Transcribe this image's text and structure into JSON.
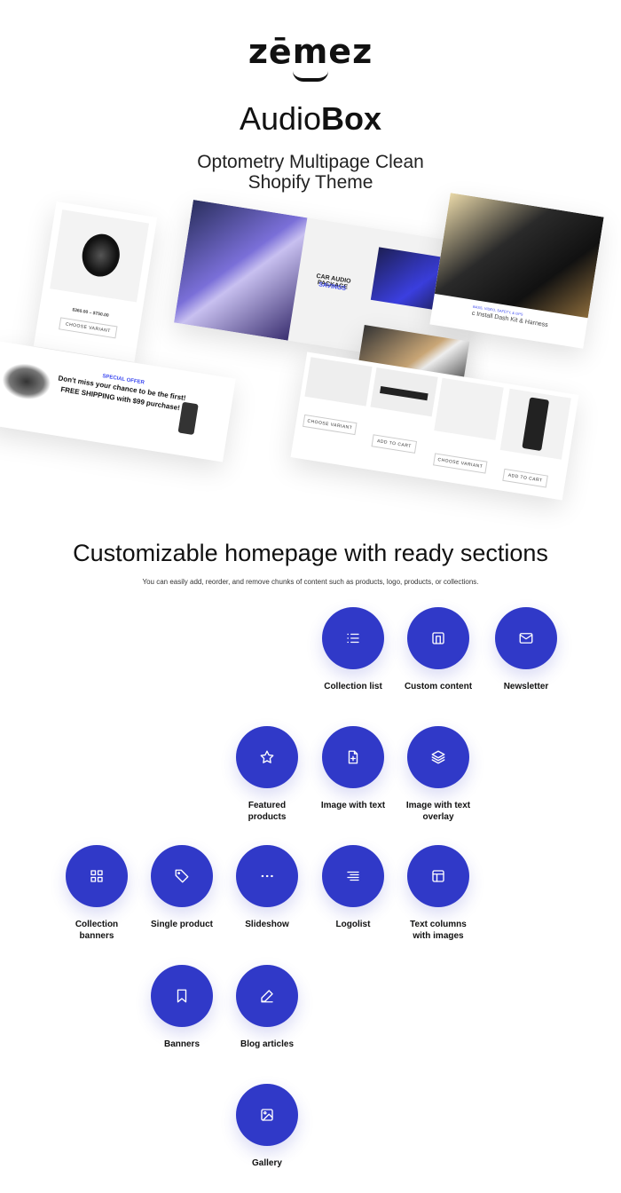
{
  "header": {
    "logo": "zēmez",
    "title_light": "Audio",
    "title_bold": "Box",
    "subtitle_line1": "Optometry Multipage Clean",
    "subtitle_line2": "Shopify Theme"
  },
  "collage": {
    "product_price": "$360.00 – $750.00",
    "choose_variant": "CHOOSE VARIANT",
    "add_to_cart": "ADD TO CART",
    "banner_title": "CAR AUDIO PACKAGE",
    "banner_accent": "SAVINGS",
    "offer_kicker": "SPECIAL OFFER",
    "offer_line1": "Don't miss your chance to be the first!",
    "offer_line2": "FREE SHIPPING with $99 purchase!",
    "dash_kicker": "BASS, VIDEO, SAFETY, & GPS",
    "dash_title": "c Install Dash Kit & Harness",
    "accent": "#3f4cf0"
  },
  "sections_intro": {
    "title": "Customizable homepage with ready sections",
    "text": "You can easily add, reorder, and remove chunks of content such as products, logo, products, or collections."
  },
  "accent_color": "#3039c8",
  "sections": [
    {
      "label": "Collection list",
      "icon": "list-icon"
    },
    {
      "label": "Custom content",
      "icon": "layout-icon"
    },
    {
      "label": "Newsletter",
      "icon": "mail-icon"
    },
    {
      "label": "Featured products",
      "icon": "star-icon"
    },
    {
      "label": "Image with text",
      "icon": "file-plus-icon"
    },
    {
      "label": "Image with text overlay",
      "icon": "layers-icon"
    },
    {
      "label": "Collection banners",
      "icon": "grid-icon"
    },
    {
      "label": "Single product",
      "icon": "tag-icon"
    },
    {
      "label": "Slideshow",
      "icon": "dots-icon"
    },
    {
      "label": "Logolist",
      "icon": "align-icon"
    },
    {
      "label": "Text columns with images",
      "icon": "columns-icon"
    },
    {
      "label": "Banners",
      "icon": "bookmark-icon"
    },
    {
      "label": "Blog articles",
      "icon": "pencil-icon"
    },
    {
      "label": "Gallery",
      "icon": "image-icon"
    }
  ]
}
